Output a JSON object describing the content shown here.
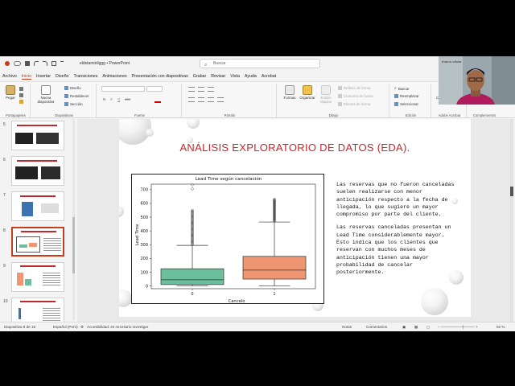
{
  "window": {
    "file_name": "eldstaminilggg",
    "app_name": "PowerPoint",
    "search_placeholder": "Buscar"
  },
  "menu": {
    "tabs": [
      "Archivo",
      "Inicio",
      "Insertar",
      "Diseño",
      "Transiciones",
      "Animaciones",
      "Presentación con diapositivas",
      "Grabar",
      "Revisar",
      "Vista",
      "Ayuda",
      "Acrobat"
    ],
    "active_tab": "Inicio"
  },
  "ribbon": {
    "paste": "Pegar",
    "portapapeles": "Portapapeles",
    "new_slide": "Nueva diapositiva",
    "layout": "Diseño",
    "reset": "Restablecer",
    "section": "Sección",
    "diapositivas": "Diapositivas",
    "font_bold": "N",
    "font_italic": "K",
    "font_underline": "S",
    "font_strike": "abc",
    "fuente": "Fuente",
    "parrafo": "Párrafo",
    "shapes": "Formas",
    "arrange": "Organizar",
    "quick_styles": "Estilos rápidos",
    "fill": "Relleno de forma",
    "outline": "Contorno de forma",
    "effects": "Efectos de forma",
    "dibujo": "Dibujo",
    "find": "Buscar",
    "replace": "Reemplazar",
    "select": "Seleccionar",
    "edicion": "Edición",
    "acrobat_btn": "Crear y compartir PDF de Adobe",
    "acrobat_group": "Adobe Acrobat",
    "complementos_btn": "Complementos",
    "complementos_group": "Complementos"
  },
  "webcam": {
    "name": "marco urbaa"
  },
  "thumbnails": [
    {
      "num": "5"
    },
    {
      "num": "6"
    },
    {
      "num": "7"
    },
    {
      "num": "8",
      "selected": true
    },
    {
      "num": "9"
    },
    {
      "num": "10"
    }
  ],
  "slide": {
    "title": "ANÁLISIS EXPLORATORIO DE DATOS (EDA).",
    "paragraph1": "Las reservas que no fueron canceladas suelen realizarse con menor anticipación respecto a la fecha de llegada, lo que sugiere un mayor compromiso por parte del cliente.",
    "paragraph2": "Las reservas canceladas presentan un Lead Time considerablemente mayor. Esto indica que los clientes que reservan con muchos meses de anticipación tienen una mayor probabilidad de cancelar posteriormente."
  },
  "chart_data": {
    "type": "box",
    "title": "Lead Time según cancelación",
    "xlabel": "Canceló",
    "ylabel": "Lead Time",
    "categories": [
      "0",
      "1"
    ],
    "ylim": [
      -20,
      740
    ],
    "yticks": [
      0,
      100,
      200,
      300,
      400,
      500,
      600,
      700
    ],
    "boxes": [
      {
        "category": "0",
        "whisker_low": 0,
        "q1": 10,
        "median": 45,
        "q3": 125,
        "whisker_high": 295,
        "outliers_from": 300,
        "outliers_to": 550,
        "extreme_outliers": [
          705,
          735
        ],
        "color": "#6dbf9b"
      },
      {
        "category": "1",
        "whisker_low": 0,
        "q1": 50,
        "median": 115,
        "q3": 215,
        "whisker_high": 465,
        "outliers_from": 470,
        "outliers_to": 630,
        "extreme_outliers": [],
        "color": "#f09572"
      }
    ]
  },
  "status": {
    "slide_info": "Diapositiva 8 de 15",
    "language": "Español (Perú)",
    "accessibility": "Accesibilidad: es necesario investigar",
    "notes": "Notas",
    "comments": "Comentarios",
    "zoom": "92 %"
  }
}
